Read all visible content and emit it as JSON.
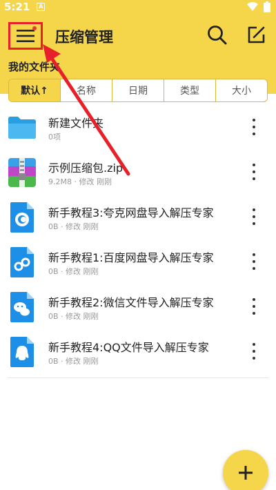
{
  "status_bar": {
    "time": "5:21",
    "badge": "A"
  },
  "header": {
    "title": "压缩管理"
  },
  "breadcrumb": "我的文件夹",
  "sort_tabs": [
    {
      "label": "默认↑",
      "active": true
    },
    {
      "label": "名称",
      "active": false
    },
    {
      "label": "日期",
      "active": false
    },
    {
      "label": "类型",
      "active": false
    },
    {
      "label": "大小",
      "active": false
    }
  ],
  "files": [
    {
      "name": "新建文件夹",
      "meta": "0项",
      "icon": "folder-icon"
    },
    {
      "name": "示例压缩包.zip",
      "meta": "9.2M8 · 修改 刚刚",
      "icon": "zip-archive-icon"
    },
    {
      "name": "新手教程3:夸克网盘导入解压专家",
      "meta": "0B · 修改 刚刚",
      "icon": "quark-doc-icon"
    },
    {
      "name": "新手教程1:百度网盘导入解压专家",
      "meta": "0B · 修改 刚刚",
      "icon": "baidu-doc-icon"
    },
    {
      "name": "新手教程2:微信文件导入解压专家",
      "meta": "0B · 修改 刚刚",
      "icon": "wechat-doc-icon"
    },
    {
      "name": "新手教程4:QQ文件导入解压专家",
      "meta": "0B · 修改 刚刚",
      "icon": "qq-doc-icon"
    }
  ],
  "colors": {
    "accent": "#f5d54a",
    "highlight_box": "#e8202a",
    "annotation_arrow": "#e8202a"
  }
}
